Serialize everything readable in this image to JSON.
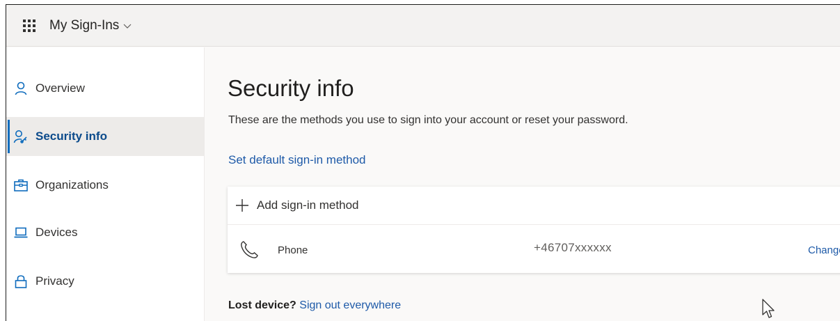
{
  "header": {
    "app_title": "My Sign-Ins",
    "launcher_icon": "waffle-icon",
    "dropdown_icon": "chevron-down-icon"
  },
  "sidebar": {
    "items": [
      {
        "label": "Overview",
        "icon": "person-icon",
        "active": false
      },
      {
        "label": "Security info",
        "icon": "person-key-icon",
        "active": true
      },
      {
        "label": "Organizations",
        "icon": "briefcase-icon",
        "active": false
      },
      {
        "label": "Devices",
        "icon": "laptop-icon",
        "active": false
      },
      {
        "label": "Privacy",
        "icon": "lock-icon",
        "active": false
      }
    ]
  },
  "main": {
    "title": "Security info",
    "description": "These are the methods you use to sign into your account or reset your password.",
    "default_link": "Set default sign-in method",
    "add_method_label": "Add sign-in method",
    "methods": [
      {
        "name": "Phone",
        "value": "+46707xxxxxx",
        "action": "Change",
        "icon": "phone-icon"
      }
    ],
    "lost_device_text": "Lost device?",
    "sign_out_link": "Sign out everywhere"
  },
  "colors": {
    "accent": "#0f6cbd",
    "link": "#1e5aa8",
    "active_bg": "#edebe9",
    "header_bg": "#f3f2f1"
  }
}
